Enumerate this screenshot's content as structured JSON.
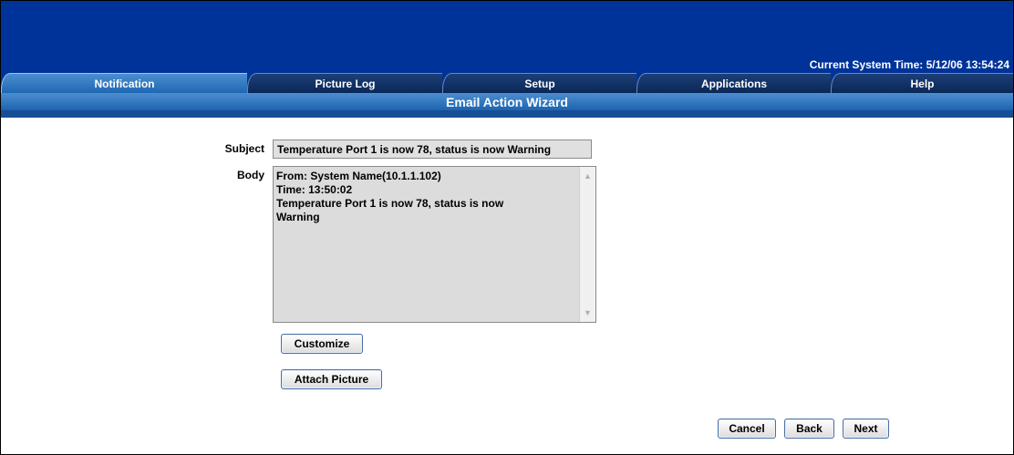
{
  "header": {
    "system_time": "Current System Time: 5/12/06 13:54:24"
  },
  "tabs": [
    {
      "label": "Notification",
      "active": true
    },
    {
      "label": "Picture Log",
      "active": false
    },
    {
      "label": "Setup",
      "active": false
    },
    {
      "label": "Applications",
      "active": false
    },
    {
      "label": "Help",
      "active": false
    }
  ],
  "wizard": {
    "title": "Email Action Wizard"
  },
  "form": {
    "subject_label": "Subject",
    "subject_value": "Temperature Port 1 is now 78, status is now Warning",
    "body_label": "Body",
    "body_lines": [
      "From: System Name(10.1.1.102)",
      "Time: 13:50:02",
      "Temperature Port 1 is now 78, status is now",
      "Warning"
    ]
  },
  "buttons": {
    "customize": "Customize",
    "attach_picture": "Attach Picture",
    "cancel": "Cancel",
    "back": "Back",
    "next": "Next"
  },
  "colors": {
    "header_bg": "#00339a",
    "tab_active": "#2f78c2",
    "tab_inactive": "#0f2e63"
  }
}
